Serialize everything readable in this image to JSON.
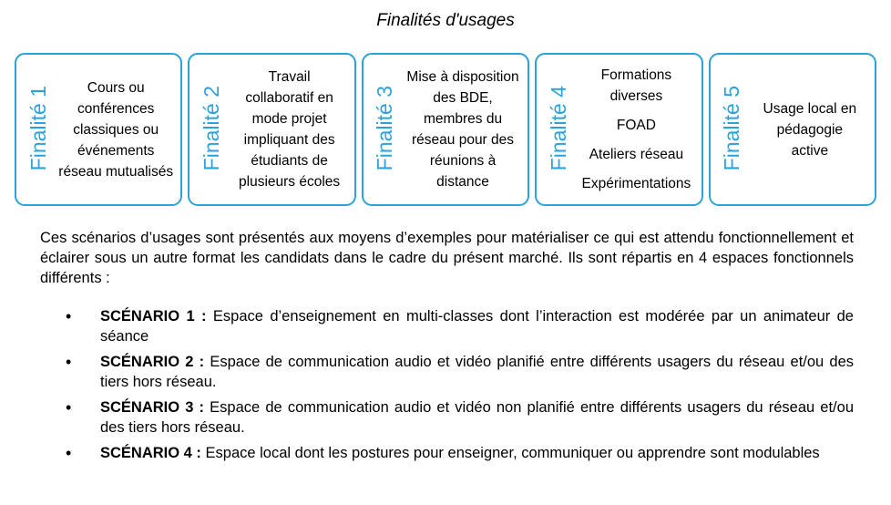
{
  "heading": "Finalités d'usages",
  "cards": [
    {
      "label": "Finalité 1",
      "lines": [
        "Cours ou conférences classiques ou événements réseau mutualisés"
      ]
    },
    {
      "label": "Finalité 2",
      "lines": [
        "Travail collaboratif en mode projet impliquant des étudiants de plusieurs écoles"
      ]
    },
    {
      "label": "Finalité 3",
      "lines": [
        "Mise à disposition des BDE, membres du réseau pour des réunions à distance"
      ]
    },
    {
      "label": "Finalité 4",
      "lines": [
        "Formations diverses",
        "FOAD",
        "Ateliers réseau",
        "Expérimentations"
      ]
    },
    {
      "label": "Finalité 5",
      "lines": [
        "Usage local en pédagogie active"
      ]
    }
  ],
  "intro": "Ces scénarios d’usages sont présentés aux moyens d’exemples pour matérialiser ce qui est attendu fonctionnellement et éclairer sous un autre format les candidats dans le cadre du présent marché. Ils sont répartis en 4 espaces fonctionnels différents :",
  "scenarios": [
    {
      "title": "SCÉNARIO 1 :",
      "text": " Espace d’enseignement en multi-classes dont l’interaction est modérée par un animateur de séance"
    },
    {
      "title": "SCÉNARIO 2 :",
      "text": " Espace de communication audio et vidéo planifié entre différents usagers du réseau et/ou des tiers hors réseau."
    },
    {
      "title": "SCÉNARIO 3 :",
      "text": " Espace de communication audio et vidéo non planifié entre différents usagers du réseau et/ou des tiers hors réseau."
    },
    {
      "title": "SCÉNARIO 4 :",
      "text": " Espace local dont les postures pour enseigner, communiquer ou apprendre sont modulables"
    }
  ],
  "bullet": "•",
  "accent_color": "#2ba3d8"
}
